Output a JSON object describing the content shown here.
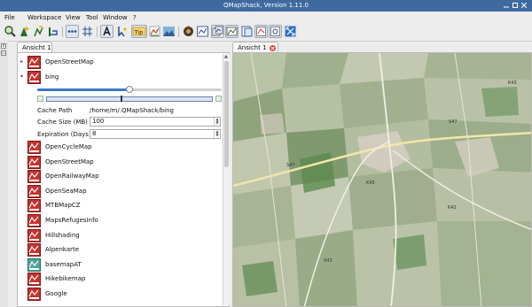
{
  "window": {
    "title": "QMapShack, Version 1.11.0"
  },
  "menu": [
    "File",
    "Workspace",
    "View",
    "Tool",
    "Window",
    "?"
  ],
  "toolbar": {
    "buttons": [
      {
        "icon": "search-map-icon",
        "active": false
      },
      {
        "icon": "add-waypoint-icon",
        "active": false
      },
      {
        "icon": "route-icon",
        "active": false
      },
      {
        "icon": "track-icon",
        "active": false
      },
      {
        "icon": "track-dots-icon",
        "active": true
      },
      {
        "icon": "grid-icon",
        "active": false
      },
      {
        "icon": "text-cursor-icon",
        "active": true
      },
      {
        "icon": "cursor-arrow-icon",
        "active": false
      },
      {
        "icon": "tip-icon",
        "active": true
      },
      {
        "icon": "chart-icon",
        "active": false
      },
      {
        "icon": "landscape-icon",
        "active": false
      },
      {
        "icon": "settings-wheel-icon",
        "active": false
      },
      {
        "icon": "map-view-icon",
        "active": false
      },
      {
        "icon": "layers-icon",
        "active": true
      },
      {
        "icon": "dem-view-icon",
        "active": true
      },
      {
        "icon": "workspace-icon",
        "active": false
      },
      {
        "icon": "database-icon",
        "active": true
      },
      {
        "icon": "geo-search-icon",
        "active": true
      },
      {
        "icon": "fullscreen-icon",
        "active": false
      }
    ]
  },
  "left_tab": {
    "label": "Ansicht 1"
  },
  "map_tab": {
    "label": "Ansicht 1"
  },
  "maps": {
    "top": [
      {
        "name": "OpenStreetMap",
        "expanded": false,
        "arrow": "▸"
      },
      {
        "name": "bing",
        "expanded": true,
        "arrow": "▾"
      }
    ],
    "bing_settings": {
      "opacity": 0.5,
      "cache_path_label": "Cache Path",
      "cache_path_value": "/home/m/.QMapShack/bing",
      "cache_size_label": "Cache Size (MB)",
      "cache_size_value": "100",
      "expiration_label": "Expiration (Days)",
      "expiration_value": "8"
    },
    "list": [
      {
        "name": "OpenCycleMap"
      },
      {
        "name": "OpenStreetMap"
      },
      {
        "name": "OpenRailwayMap"
      },
      {
        "name": "OpenSeaMap"
      },
      {
        "name": "MTBMapCZ"
      },
      {
        "name": "MapsRefugesInfo"
      },
      {
        "name": "Hillshading"
      },
      {
        "name": "Alpenkarte"
      },
      {
        "name": "basemapAT",
        "teal": true
      },
      {
        "name": "Hikebikemap"
      },
      {
        "name": "Google"
      }
    ]
  },
  "map_labels": {
    "road_ids": [
      "K43",
      "S47",
      "K45",
      "K42",
      "S43",
      "S47"
    ]
  }
}
